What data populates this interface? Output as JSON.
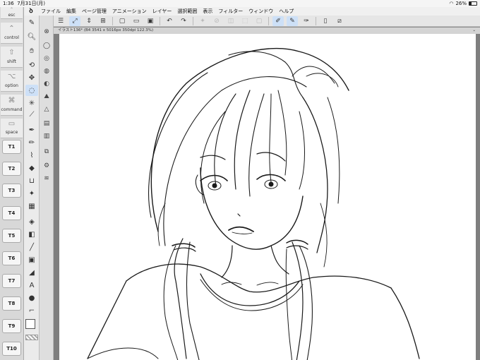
{
  "status": {
    "time": "1:36",
    "date": "7月31日(月)",
    "battery": "26%",
    "battery_level": 0.26
  },
  "menu": {
    "items": [
      "ファイル",
      "編集",
      "ページ管理",
      "アニメーション",
      "レイヤー",
      "選択範囲",
      "表示",
      "フィルター",
      "ウィンドウ",
      "ヘルプ"
    ]
  },
  "edge_keys": {
    "esc": "esc",
    "control": "control",
    "shift": "shift",
    "option": "option",
    "command": "command",
    "space": "space",
    "t_keys": [
      "T1",
      "T2",
      "T3",
      "T4",
      "T5",
      "T6",
      "T7",
      "T8",
      "T9",
      "T10"
    ]
  },
  "document": {
    "tab_title": "イラスト136* (B4 3541 x 5016px 350dpi 122.3%)"
  },
  "colors": {
    "accent": "#cde0f7",
    "main_color": "#ffffff",
    "sub_color": "#222222"
  },
  "icons": {
    "toolbar": [
      "menu-icon",
      "canvas-move-icon",
      "sort-icon",
      "quick-access-icon",
      "new-file-icon",
      "open-icon",
      "save-icon",
      "undo-icon",
      "redo-icon",
      "selection-clear-icon",
      "lasso-deselect-icon",
      "invert-icon",
      "transform-icon",
      "pen-correction-icon",
      "pen-stabilize-icon",
      "pen-vector-icon",
      "document-icon",
      "flip-icon"
    ]
  }
}
